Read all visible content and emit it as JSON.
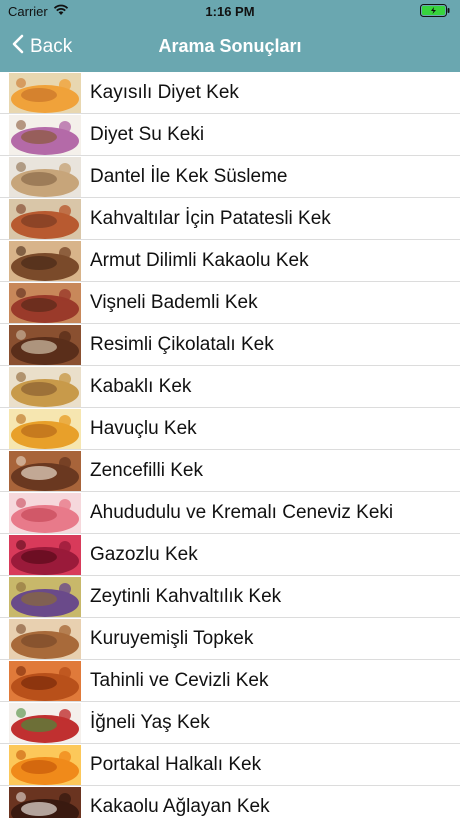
{
  "status_bar": {
    "carrier": "Carrier",
    "time": "1:16 PM"
  },
  "nav": {
    "back_label": "Back",
    "title": "Arama Sonuçları"
  },
  "results": [
    {
      "label": "Kayısılı Diyet Kek",
      "colors": [
        "#f0a23a",
        "#e8d7b0",
        "#c9752a"
      ]
    },
    {
      "label": "Diyet Su Keki",
      "colors": [
        "#b46aa8",
        "#f4f0ea",
        "#8a5a3a"
      ]
    },
    {
      "label": "Dantel İle Kek Süsleme",
      "colors": [
        "#c7a57a",
        "#e9e4dc",
        "#8b6b4a"
      ]
    },
    {
      "label": "Kahvaltılar İçin Patatesli Kek",
      "colors": [
        "#b85a30",
        "#d9c6a8",
        "#7a3a22"
      ]
    },
    {
      "label": "Armut Dilimli Kakaolu Kek",
      "colors": [
        "#7a4a2a",
        "#d8b48a",
        "#4a2a18"
      ]
    },
    {
      "label": "Vişneli Bademli Kek",
      "colors": [
        "#9a3a2a",
        "#c8885a",
        "#5a2a1a"
      ]
    },
    {
      "label": "Resimli Çikolatalı Kek",
      "colors": [
        "#5a2e1a",
        "#8a5030",
        "#d0c0a8"
      ]
    },
    {
      "label": "Kabaklı Kek",
      "colors": [
        "#c89a4a",
        "#eadfca",
        "#8a6030"
      ]
    },
    {
      "label": "Havuçlu Kek",
      "colors": [
        "#e8a02a",
        "#f6e6b0",
        "#b86a1a"
      ]
    },
    {
      "label": "Zencefilli Kek",
      "colors": [
        "#6a3820",
        "#a8643a",
        "#e8d8c8"
      ]
    },
    {
      "label": "Ahududulu ve Kremalı Ceneviz Keki",
      "colors": [
        "#e87a8a",
        "#f6d8dc",
        "#c84a5a"
      ]
    },
    {
      "label": "Gazozlu Kek",
      "colors": [
        "#9a1a3a",
        "#d83a5a",
        "#5a0a1a"
      ]
    },
    {
      "label": "Zeytinli Kahvaltılık Kek",
      "colors": [
        "#6a4a8a",
        "#c8b86a",
        "#8a6a3a"
      ]
    },
    {
      "label": "Kuruyemişli Topkek",
      "colors": [
        "#a86a3a",
        "#e8d0b0",
        "#7a4a2a"
      ]
    },
    {
      "label": "Tahinli ve Cevizli Kek",
      "colors": [
        "#b8501a",
        "#e07a3a",
        "#7a2a0a"
      ]
    },
    {
      "label": "İğneli Yaş Kek",
      "colors": [
        "#c03030",
        "#f4f0ec",
        "#4a8a3a"
      ]
    },
    {
      "label": "Portakal Halkalı Kek",
      "colors": [
        "#f08a1a",
        "#fcc85a",
        "#c85a0a"
      ]
    },
    {
      "label": "Kakaolu Ağlayan Kek",
      "colors": [
        "#3a1a10",
        "#6a3420",
        "#e8e0d8"
      ]
    }
  ]
}
